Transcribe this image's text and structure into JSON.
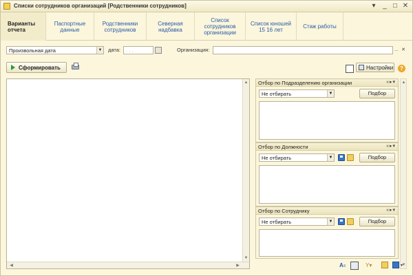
{
  "window": {
    "title": "Списки сотрудников организаций [Родственники сотрудников]",
    "controls": {
      "menu": "▾",
      "minimize": "_",
      "maximize": "□",
      "close": "✕"
    }
  },
  "tabs": [
    {
      "label": "Варианты отчета",
      "active": true
    },
    {
      "label": "Паспортные данные"
    },
    {
      "label": "Родственники сотрудников"
    },
    {
      "label": "Северная надбавка"
    },
    {
      "label": "Список сотрудников организации"
    },
    {
      "label": "Список юношей 15 16 лет"
    },
    {
      "label": "Стаж работы"
    }
  ],
  "period": {
    "value": "Произвольная дата"
  },
  "date": {
    "label": "дата:",
    "placeholder": ". . ."
  },
  "organization": {
    "label": "Организация:",
    "value": "",
    "select_glyph": "...",
    "clear_glyph": "✕"
  },
  "toolbar": {
    "generate_label": "Сформировать",
    "settings_label": "Настройки",
    "help_glyph": "?"
  },
  "filters": [
    {
      "title": "Отбор по Подразделению организации",
      "mode": "Не отбирать",
      "pick_label": "Подбор",
      "controls": "«▸▾",
      "has_file_icons": false
    },
    {
      "title": "Отбор по Должности",
      "mode": "Не отбирать",
      "pick_label": "Подбор",
      "controls": "«▸▾",
      "has_file_icons": true
    },
    {
      "title": "Отбор по Сотруднику",
      "mode": "Не отбирать",
      "pick_label": "Подбор",
      "controls": "«▸▾",
      "has_file_icons": true
    }
  ],
  "colors": {
    "window_bg": "#fbf6dc",
    "tab_link": "#2a5aa8",
    "play_green": "#2e9a2e",
    "help_orange": "#f0a629"
  }
}
